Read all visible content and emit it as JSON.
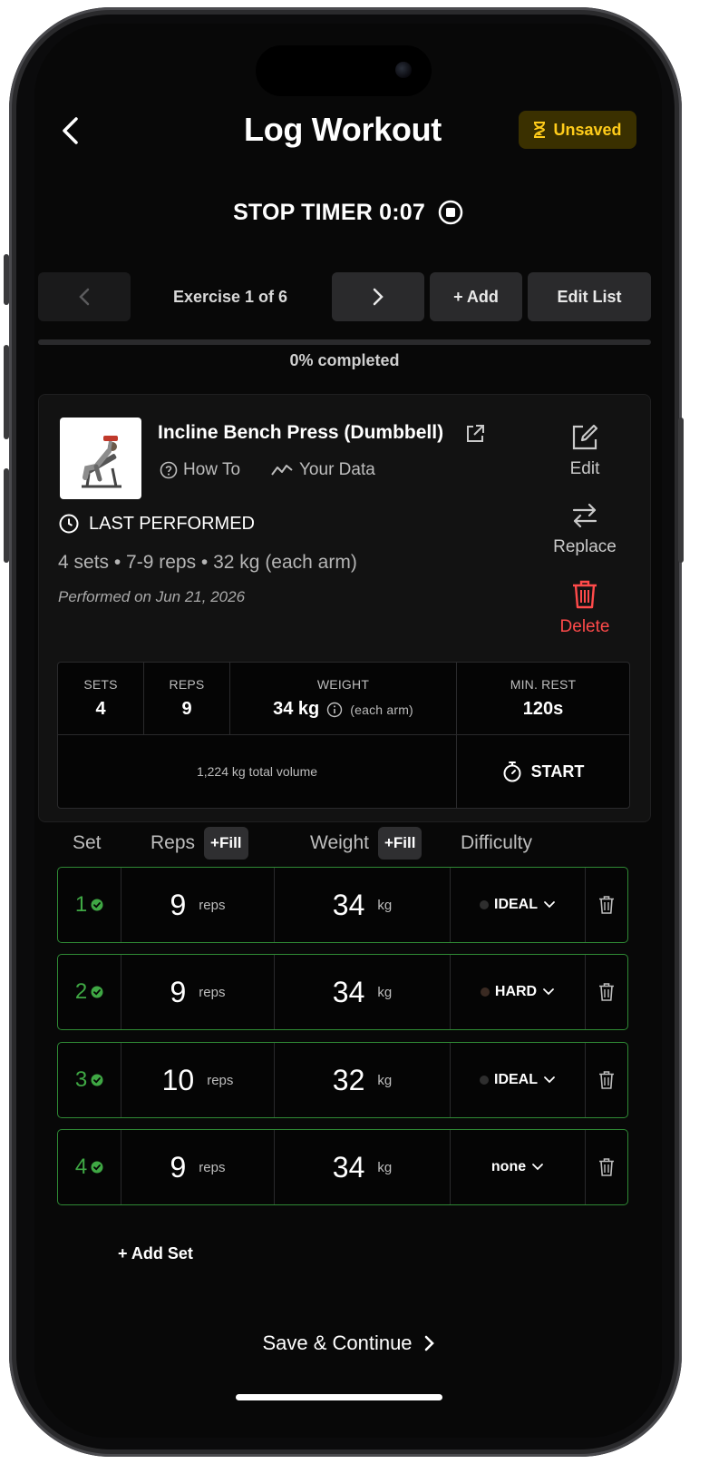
{
  "header": {
    "title": "Log Workout",
    "status_badge": "Unsaved"
  },
  "timer": {
    "label": "STOP TIMER 0:07"
  },
  "nav": {
    "exercise_count": "Exercise 1 of 6",
    "add_label": "+ Add",
    "edit_list_label": "Edit List"
  },
  "progress": {
    "percent": 0,
    "label": "0% completed"
  },
  "exercise": {
    "name": "Incline Bench Press (Dumbbell)",
    "how_to": "How To",
    "your_data": "Your Data",
    "last_performed_label": "LAST PERFORMED",
    "last_summary": "4 sets • 7-9 reps • 32 kg (each arm)",
    "last_date": "Performed on Jun 21, 2026",
    "actions": {
      "edit": "Edit",
      "replace": "Replace",
      "delete": "Delete"
    }
  },
  "stats": {
    "sets_label": "SETS",
    "sets": "4",
    "reps_label": "REPS",
    "reps": "9",
    "weight_label": "WEIGHT",
    "weight": "34 kg",
    "weight_note": "(each arm)",
    "rest_label": "MIN. REST",
    "rest": "120s",
    "volume": "1,224 kg total volume",
    "start_label": "START"
  },
  "table": {
    "set": "Set",
    "reps": "Reps",
    "weight": "Weight",
    "difficulty": "Difficulty",
    "fill": "+Fill"
  },
  "sets": [
    {
      "num": "1",
      "reps": "9",
      "reps_unit": "reps",
      "weight": "34",
      "weight_unit": "kg",
      "difficulty": "IDEAL",
      "dot": "#2e2e2e"
    },
    {
      "num": "2",
      "reps": "9",
      "reps_unit": "reps",
      "weight": "34",
      "weight_unit": "kg",
      "difficulty": "HARD",
      "dot": "#3a2a22"
    },
    {
      "num": "3",
      "reps": "10",
      "reps_unit": "reps",
      "weight": "32",
      "weight_unit": "kg",
      "difficulty": "IDEAL",
      "dot": "#2e2e2e"
    },
    {
      "num": "4",
      "reps": "9",
      "reps_unit": "reps",
      "weight": "34",
      "weight_unit": "kg",
      "difficulty": "none",
      "dot": ""
    }
  ],
  "footer": {
    "add_set": "+ Add Set",
    "save": "Save & Continue"
  },
  "colors": {
    "accent_green": "#3fa844",
    "unsaved_yellow": "#ffcc1a",
    "delete_red": "#ff4a4a"
  }
}
